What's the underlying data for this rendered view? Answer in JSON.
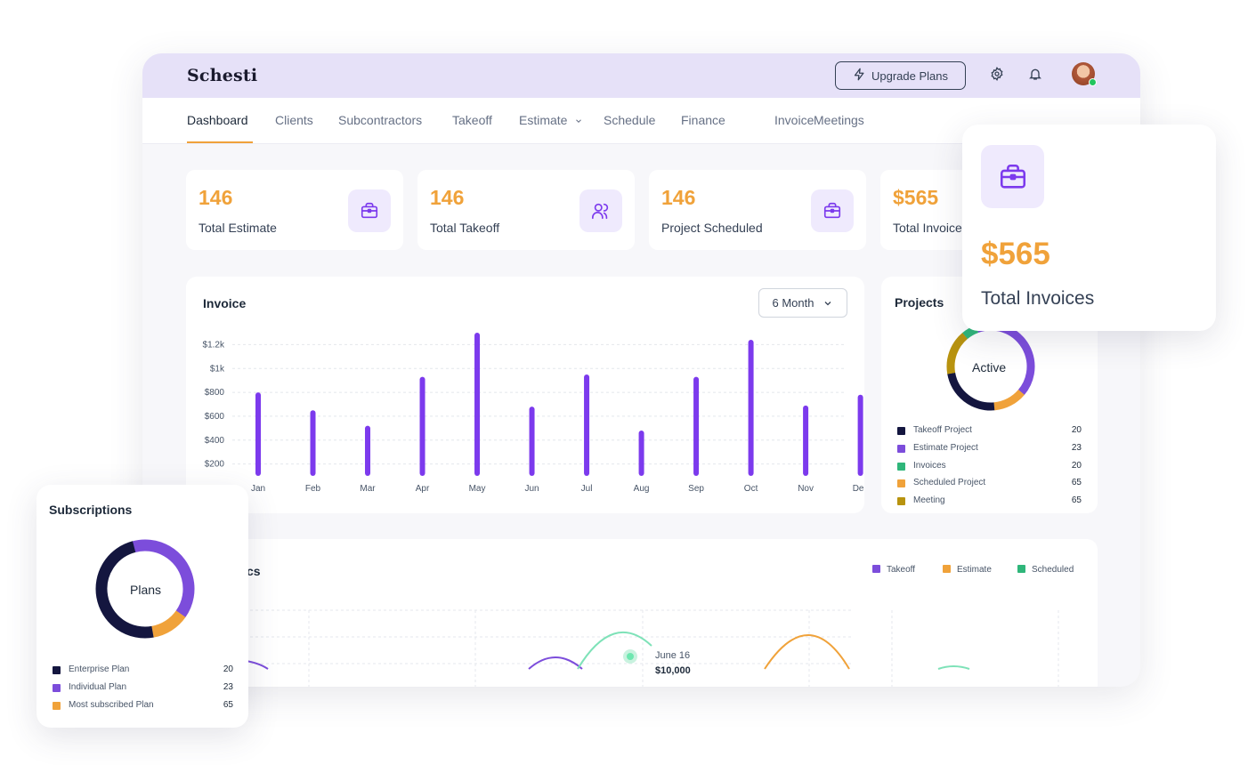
{
  "brand": {
    "logo_text": "Schesti"
  },
  "header": {
    "upgrade_label": "Upgrade Plans",
    "settings_icon": "gear-icon",
    "bell_icon": "bell-icon",
    "online_color": "#22c55e"
  },
  "nav": {
    "items": [
      {
        "label": "Dashboard",
        "active": true
      },
      {
        "label": "Clients"
      },
      {
        "label": "Subcontractors"
      },
      {
        "label": "Takeoff"
      },
      {
        "label": "Estimate",
        "has_dropdown": true
      },
      {
        "label": "Schedule"
      },
      {
        "label": "Finance"
      },
      {
        "label": "Invoice"
      },
      {
        "label": "Meetings"
      }
    ]
  },
  "stats": [
    {
      "value": "146",
      "label": "Total Estimate",
      "icon": "briefcase-icon"
    },
    {
      "value": "146",
      "label": "Total Takeoff",
      "icon": "users-icon"
    },
    {
      "value": "146",
      "label": "Project Scheduled",
      "icon": "briefcase-icon"
    },
    {
      "value": "$565",
      "label": "Total Invoices",
      "icon": "briefcase-icon"
    }
  ],
  "invoice_panel": {
    "title": "Invoice",
    "range_selected": "6 Month"
  },
  "projects_panel": {
    "title": "Projects",
    "center_label": "Active",
    "legend": [
      {
        "label": "Takeoff Project",
        "value": "20",
        "color": "#14163f"
      },
      {
        "label": "Estimate Project",
        "value": "23",
        "color": "#7c4ddb"
      },
      {
        "label": "Invoices",
        "value": "20",
        "color": "#2fb67a"
      },
      {
        "label": "Scheduled Project",
        "value": "65",
        "color": "#f0a23a"
      },
      {
        "label": "Meeting",
        "value": "65",
        "color": "#b8930f"
      }
    ]
  },
  "popup": {
    "value": "$565",
    "label": "Total Invoices",
    "icon": "briefcase-icon"
  },
  "statistics_panel": {
    "title_visible": "cs",
    "legend": [
      {
        "label": "Takeoff",
        "color": "#7c4ddb"
      },
      {
        "label": "Estimate",
        "color": "#f0a23a"
      },
      {
        "label": "Scheduled",
        "color": "#2fb67a"
      }
    ],
    "tooltip_date": "June 16",
    "tooltip_value": "$10,000"
  },
  "subscriptions": {
    "title": "Subscriptions",
    "center_label": "Plans",
    "legend": [
      {
        "label": "Enterprise Plan",
        "value": "20",
        "color": "#14163f"
      },
      {
        "label": "Individual Plan",
        "value": "23",
        "color": "#7c4ddb"
      },
      {
        "label": "Most subscribed Plan",
        "value": "65",
        "color": "#f0a23a"
      }
    ]
  },
  "chart_data": [
    {
      "type": "bar",
      "title": "Invoice",
      "categories": [
        "Jan",
        "Feb",
        "Mar",
        "Apr",
        "May",
        "Jun",
        "Jul",
        "Aug",
        "Sep",
        "Oct",
        "Nov",
        "Dec"
      ],
      "values": [
        800,
        650,
        520,
        930,
        1300,
        680,
        950,
        480,
        930,
        1240,
        690,
        780
      ],
      "ytick_labels": [
        "$200",
        "$400",
        "$600",
        "$800",
        "$1k",
        "$1.2k"
      ],
      "yticks": [
        200,
        400,
        600,
        800,
        1000,
        1200
      ],
      "ylim": [
        100,
        1300
      ],
      "grid": true,
      "color": "#7c3aed"
    },
    {
      "type": "pie",
      "title": "Projects",
      "labels": [
        "Takeoff Project",
        "Estimate Project",
        "Invoices",
        "Scheduled Project",
        "Meeting"
      ],
      "values": [
        20,
        23,
        20,
        65,
        65
      ]
    },
    {
      "type": "pie",
      "title": "Subscriptions",
      "labels": [
        "Enterprise Plan",
        "Individual Plan",
        "Most subscribed Plan"
      ],
      "values": [
        20,
        23,
        65
      ]
    }
  ]
}
